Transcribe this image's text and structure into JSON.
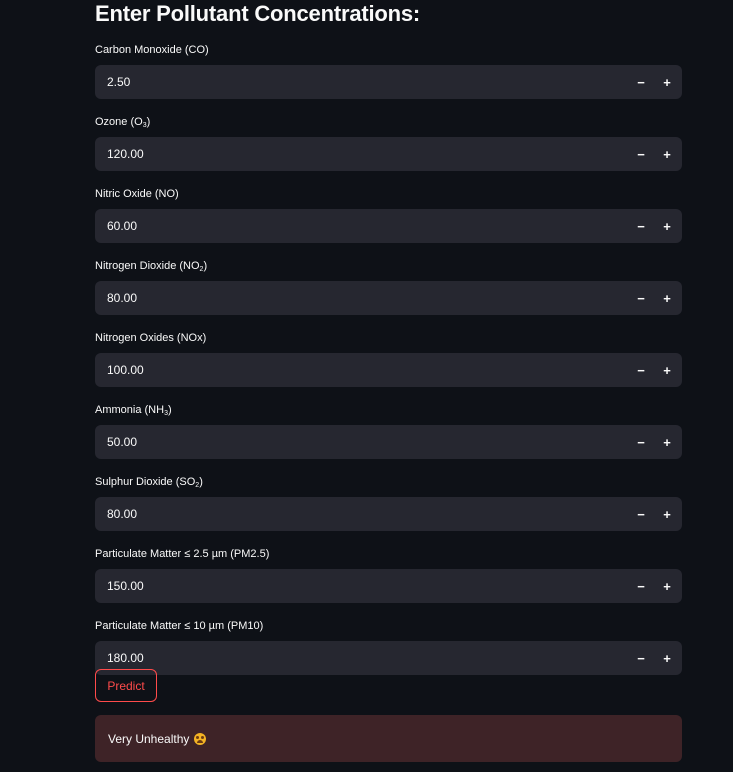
{
  "page": {
    "title": "Enter Pollutant Concentrations:"
  },
  "fields": [
    {
      "label_main": "Carbon Monoxide (CO)",
      "label_sub": "",
      "label_end": "",
      "value": "2.50"
    },
    {
      "label_main": "Ozone (O",
      "label_sub": "3",
      "label_end": ")",
      "value": "120.00"
    },
    {
      "label_main": "Nitric Oxide (NO)",
      "label_sub": "",
      "label_end": "",
      "value": "60.00"
    },
    {
      "label_main": "Nitrogen Dioxide (NO",
      "label_sub": "2",
      "label_end": ")",
      "value": "80.00"
    },
    {
      "label_main": "Nitrogen Oxides (NOx)",
      "label_sub": "",
      "label_end": "",
      "value": "100.00"
    },
    {
      "label_main": "Ammonia (NH",
      "label_sub": "3",
      "label_end": ")",
      "value": "50.00"
    },
    {
      "label_main": "Sulphur Dioxide (SO",
      "label_sub": "2",
      "label_end": ")",
      "value": "80.00"
    },
    {
      "label_main": "Particulate Matter ≤ 2.5 µm (PM2.5)",
      "label_sub": "",
      "label_end": "",
      "value": "150.00"
    },
    {
      "label_main": "Particulate Matter ≤ 10 µm (PM10)",
      "label_sub": "",
      "label_end": "",
      "value": "180.00"
    }
  ],
  "stepper": {
    "minus": "−",
    "plus": "+"
  },
  "predict_button": {
    "label": "Predict"
  },
  "result": {
    "text": "Very Unhealthy",
    "icon": "nauseated-face-icon"
  },
  "colors": {
    "background": "#0e1117",
    "input_bg": "#262730",
    "accent": "#ff4b4b",
    "result_bg": "#3e2327"
  }
}
